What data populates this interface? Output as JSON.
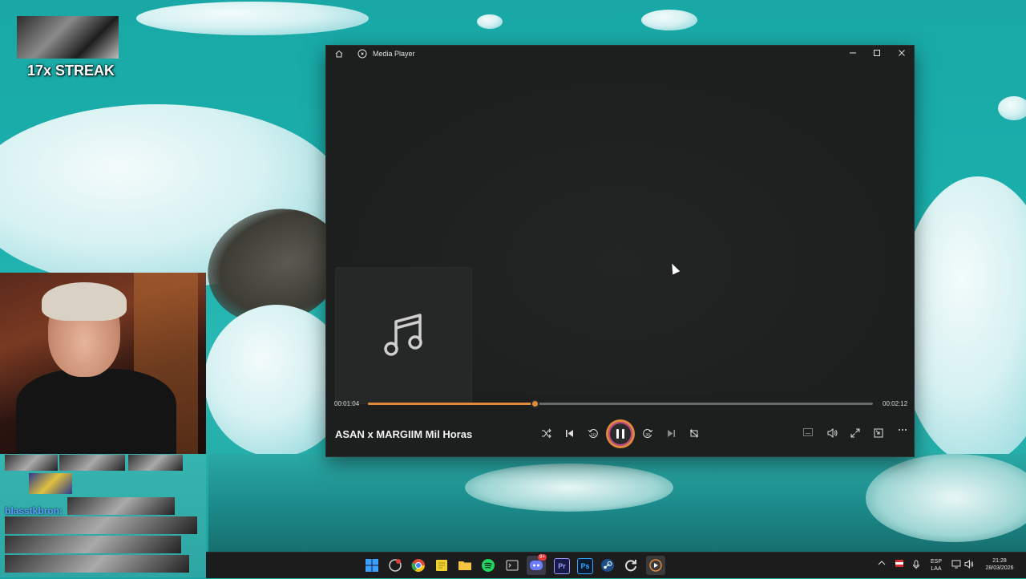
{
  "overlay": {
    "streak_text": "17x STREAK",
    "chat_username": "blasstkbron:"
  },
  "media_player": {
    "window_title": "Media Player",
    "track_title": "ASAN x MARGIIM Mil Horas",
    "elapsed": "00:01:04",
    "duration": "00:02:12",
    "progress_fraction": 0.33,
    "skip_back_seconds": "10",
    "skip_forward_seconds": "30",
    "accent_color": "#e08a3a",
    "controls": [
      "shuffle-icon",
      "previous-icon",
      "skip-back-icon",
      "pause-icon",
      "skip-forward-icon",
      "next-icon",
      "repeat-icon"
    ],
    "right_controls": [
      "captions-icon",
      "volume-icon",
      "fullscreen-icon",
      "mini-player-icon",
      "more-icon"
    ]
  },
  "taskbar": {
    "apps": [
      "windows-start",
      "browser-alt",
      "chrome",
      "notes",
      "file-explorer",
      "spotify",
      "terminal",
      "discord",
      "premiere-pro",
      "photoshop",
      "steam",
      "refresh-app",
      "media-player"
    ],
    "discord_badge": "9+",
    "premiere_label": "Pr",
    "photoshop_label": "Ps",
    "language_top": "ESP",
    "language_bottom": "LAA",
    "time": "21:28",
    "date": "28/03/2026"
  }
}
